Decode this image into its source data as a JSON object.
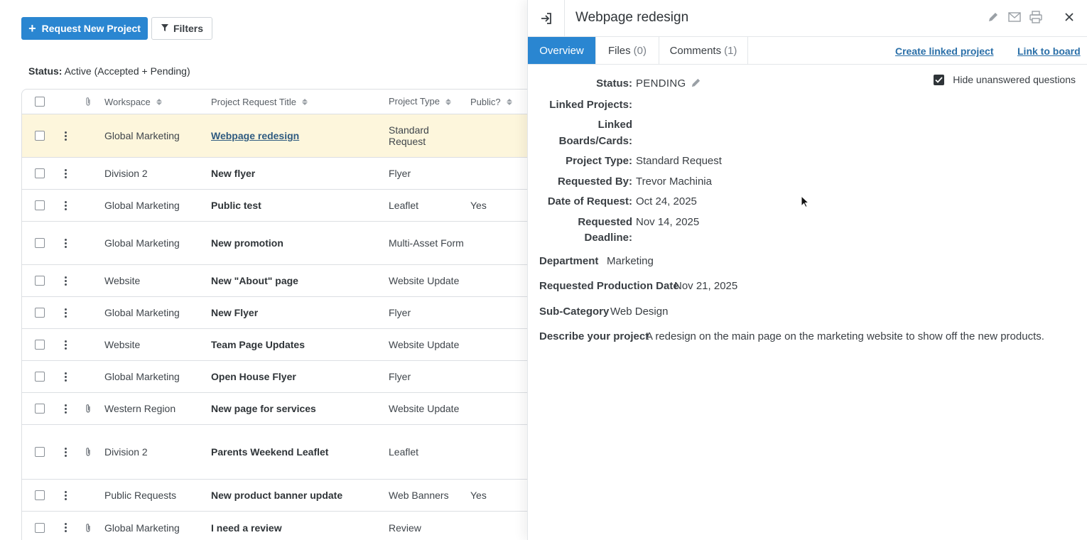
{
  "toolbar": {
    "request_label": "Request New Project",
    "filters_label": "Filters"
  },
  "status_filter": {
    "label": "Status:",
    "value": "Active (Accepted + Pending)"
  },
  "table": {
    "columns": {
      "workspace": "Workspace",
      "title": "Project Request Title",
      "type": "Project Type",
      "public": "Public?"
    },
    "rows": [
      {
        "workspace": "Global Marketing",
        "title": "Webpage redesign",
        "type": "Standard Request",
        "public": ""
      },
      {
        "workspace": "Division 2",
        "title": "New flyer",
        "type": "Flyer",
        "public": ""
      },
      {
        "workspace": "Global Marketing",
        "title": "Public test",
        "type": "Leaflet",
        "public": "Yes"
      },
      {
        "workspace": "Global Marketing",
        "title": "New promotion",
        "type": "Multi-Asset Form",
        "public": ""
      },
      {
        "workspace": "Website",
        "title": "New \"About\" page",
        "type": "Website Update",
        "public": ""
      },
      {
        "workspace": "Global Marketing",
        "title": "New Flyer",
        "type": "Flyer",
        "public": ""
      },
      {
        "workspace": "Website",
        "title": "Team Page Updates",
        "type": "Website Update",
        "public": ""
      },
      {
        "workspace": "Global Marketing",
        "title": "Open House Flyer",
        "type": "Flyer",
        "public": ""
      },
      {
        "workspace": "Western Region",
        "title": "New page for services",
        "type": "Website Update",
        "public": ""
      },
      {
        "workspace": "Division 2",
        "title": "Parents Weekend Leaflet",
        "type": "Leaflet",
        "public": ""
      },
      {
        "workspace": "Public Requests",
        "title": "New product banner update",
        "type": "Web Banners",
        "public": "Yes"
      },
      {
        "workspace": "Global Marketing",
        "title": "I need a review",
        "type": "Review",
        "public": ""
      }
    ]
  },
  "panel": {
    "title": "Webpage redesign",
    "tabs": {
      "overview": "Overview",
      "files": "Files",
      "files_count": "(0)",
      "comments": "Comments",
      "comments_count": "(1)"
    },
    "links": {
      "create": "Create linked project",
      "board": "Link to board"
    },
    "hide_unanswered": "Hide unanswered questions",
    "fields": {
      "status_label": "Status:",
      "status_value": "PENDING",
      "linked_projects_label": "Linked Projects:",
      "linked_boards_label_1": "Linked",
      "linked_boards_label_2": "Boards/Cards:",
      "project_type_label": "Project Type:",
      "project_type_value": "Standard Request",
      "requested_by_label": "Requested By:",
      "requested_by_value": "Trevor Machinia",
      "date_label": "Date of Request:",
      "date_value": "Oct 24, 2025",
      "deadline_label_1": "Requested",
      "deadline_label_2": "Deadline:",
      "deadline_value": "Nov 14, 2025",
      "department_label": "Department",
      "department_value": "Marketing",
      "production_label": "Requested Production Date",
      "production_value": "Nov 21, 2025",
      "subcat_label": "Sub-Category",
      "subcat_value": "Web Design",
      "describe_label": "Describe your project",
      "describe_value": "A redesign on the main page on the marketing website to show off the new products."
    }
  }
}
